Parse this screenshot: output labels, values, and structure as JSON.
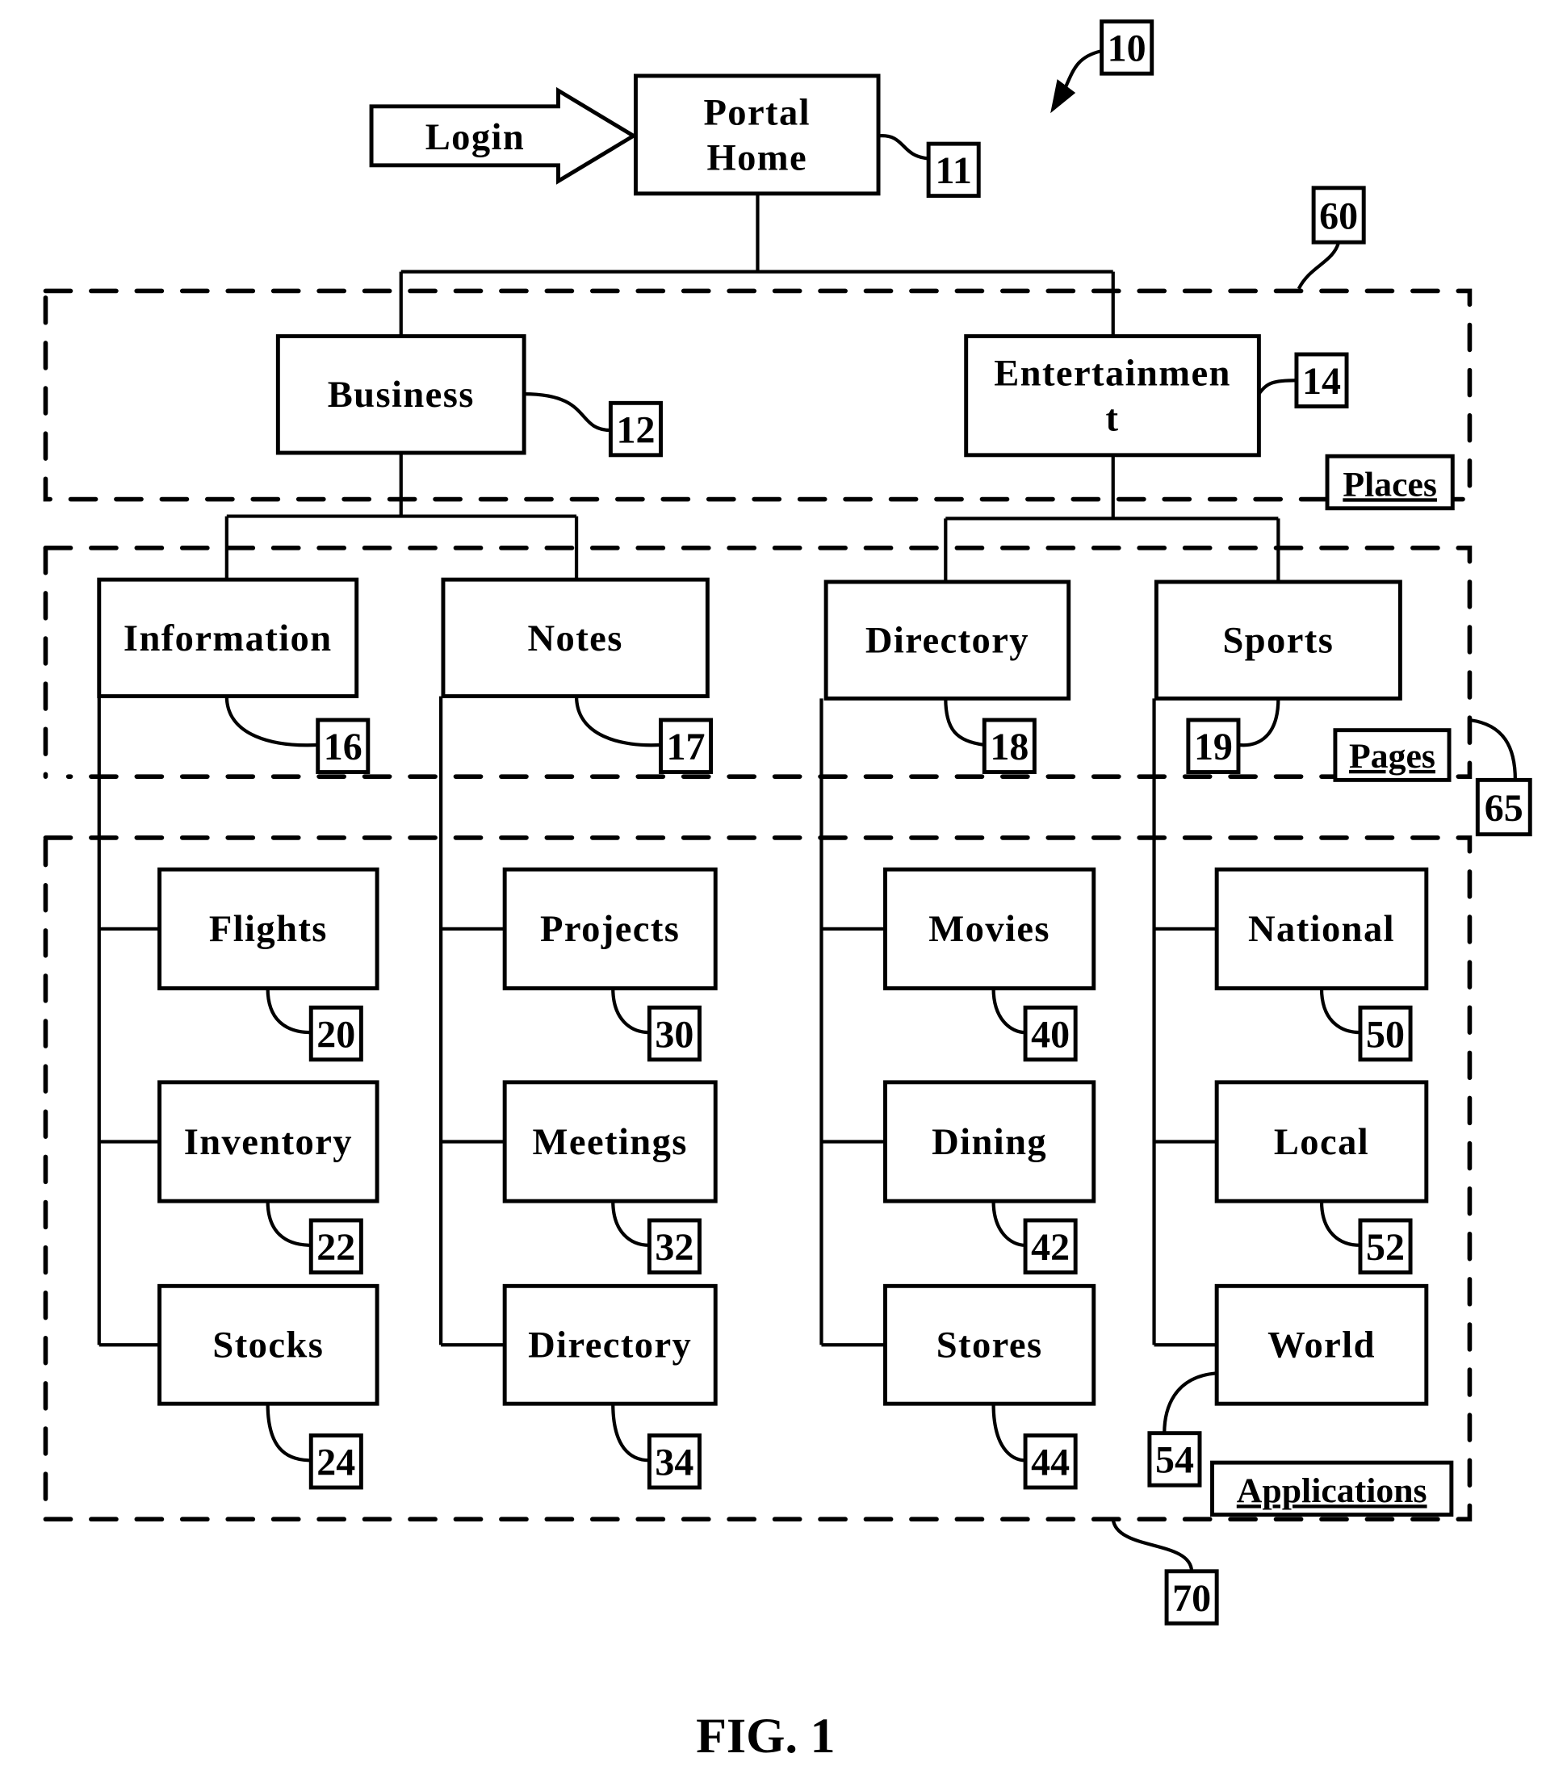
{
  "figure": {
    "caption": "FIG. 1",
    "reference": "10"
  },
  "login": {
    "label": "Login"
  },
  "portal_home": {
    "line1": "Portal",
    "line2": "Home",
    "ref": "11"
  },
  "places": [
    {
      "id": "business",
      "lines": [
        "Business"
      ],
      "ref": "12"
    },
    {
      "id": "entertainment",
      "lines": [
        "Entertainmen",
        "t"
      ],
      "ref": "14"
    }
  ],
  "pages": [
    {
      "id": "information",
      "label": "Information",
      "ref": "16",
      "parent": "business"
    },
    {
      "id": "notes",
      "label": "Notes",
      "ref": "17",
      "parent": "business"
    },
    {
      "id": "directory",
      "label": "Directory",
      "ref": "18",
      "parent": "entertainment"
    },
    {
      "id": "sports",
      "label": "Sports",
      "ref": "19",
      "parent": "entertainment"
    }
  ],
  "applications": [
    {
      "page": "information",
      "items": [
        {
          "label": "Flights",
          "ref": "20"
        },
        {
          "label": "Inventory",
          "ref": "22"
        },
        {
          "label": "Stocks",
          "ref": "24"
        }
      ]
    },
    {
      "page": "notes",
      "items": [
        {
          "label": "Projects",
          "ref": "30"
        },
        {
          "label": "Meetings",
          "ref": "32"
        },
        {
          "label": "Directory",
          "ref": "34"
        }
      ]
    },
    {
      "page": "directory",
      "items": [
        {
          "label": "Movies",
          "ref": "40"
        },
        {
          "label": "Dining",
          "ref": "42"
        },
        {
          "label": "Stores",
          "ref": "44"
        }
      ]
    },
    {
      "page": "sports",
      "items": [
        {
          "label": "National",
          "ref": "50"
        },
        {
          "label": "Local",
          "ref": "52"
        },
        {
          "label": "World",
          "ref": "54"
        }
      ]
    }
  ],
  "regions": {
    "places": {
      "label": "Places",
      "ref": "60"
    },
    "pages": {
      "label": "Pages",
      "ref": "65"
    },
    "applications": {
      "label": "Applications",
      "ref": "70"
    }
  }
}
